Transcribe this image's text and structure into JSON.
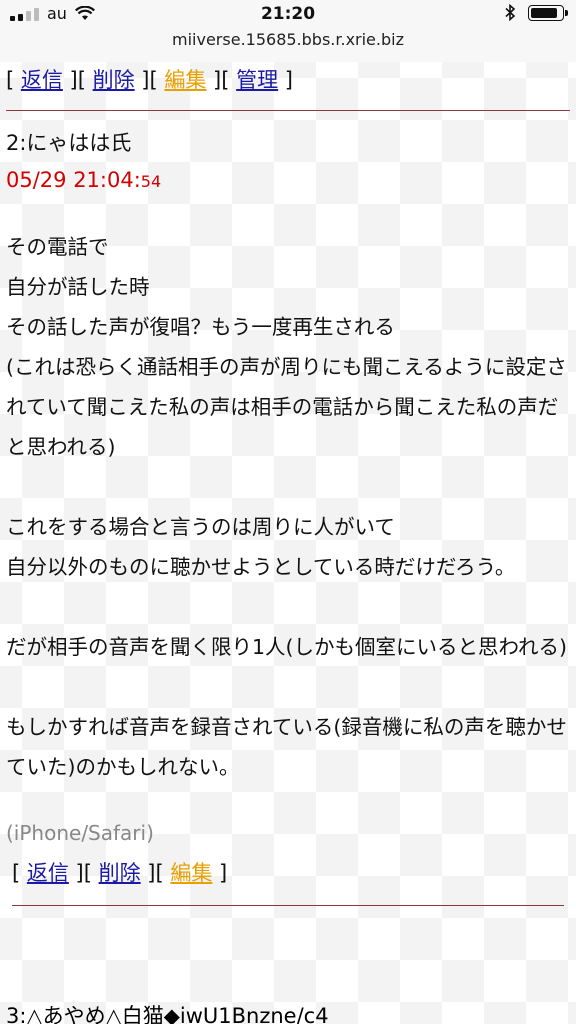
{
  "status_bar": {
    "carrier": "au",
    "time": "21:20",
    "url": "miiverse.15685.bbs.r.xrie.biz"
  },
  "top_actions": {
    "reply": "返信",
    "delete": "削除",
    "edit": "編集",
    "admin": "管理"
  },
  "post": {
    "number_and_name": "2:にゃはは氏",
    "date": "05/29 21:04:",
    "seconds": "54",
    "body": "その電話で\n自分が話した時\nその話した声が復唱？もう一度再生される\n(これは恐らく通話相手の声が周りにも聞こえるように設定されていて聞こえた私の声は相手の電話から聞こえた私の声だと思われる)\n\nこれをする場合と言うのは周りに人がいて\n自分以外のものに聴かせようとしている時だけだろう。\n\nだが相手の音声を聞く限り1人(しかも個室にいると思われる)\n\nもしかすれば音声を録音されている(録音機に私の声を聴かせていた)のかもしれない。",
    "user_agent": "(iPhone/Safari)"
  },
  "bottom_actions": {
    "reply": "返信",
    "delete": "削除",
    "edit": "編集"
  },
  "next_post": {
    "number_and_name": "3:△あやめ△白猫◆iwU1Bnzne/c4"
  },
  "colors": {
    "link": "#1a1aa6",
    "edit_link": "#e8a000",
    "date": "#d40000",
    "divider": "#8b3a3a",
    "user_agent": "#888888"
  }
}
